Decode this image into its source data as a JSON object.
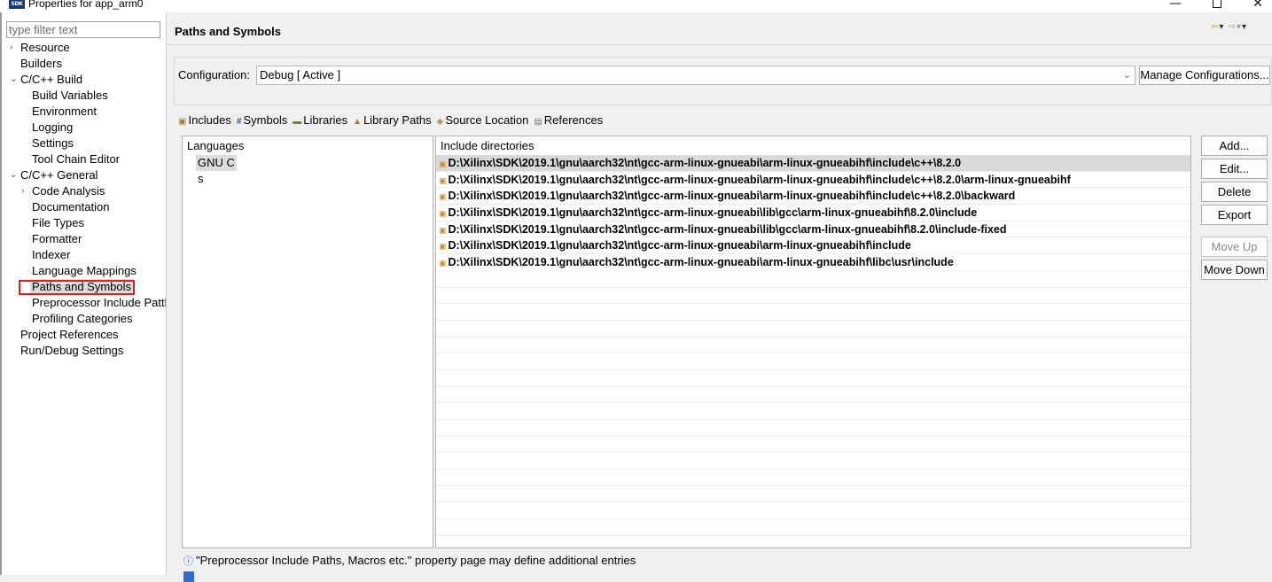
{
  "window": {
    "title": "Properties for app_arm0",
    "app_icon_text": "SDK",
    "minimize": "—",
    "close": "✕"
  },
  "filter": {
    "placeholder": "type filter text",
    "value": ""
  },
  "nav_tree": [
    {
      "label": "Resource",
      "level": 0,
      "chevron": "›"
    },
    {
      "label": "Builders",
      "level": 0,
      "chevron": ""
    },
    {
      "label": "C/C++ Build",
      "level": 0,
      "chevron": "⌄"
    },
    {
      "label": "Build Variables",
      "level": 1,
      "chevron": ""
    },
    {
      "label": "Environment",
      "level": 1,
      "chevron": ""
    },
    {
      "label": "Logging",
      "level": 1,
      "chevron": ""
    },
    {
      "label": "Settings",
      "level": 1,
      "chevron": ""
    },
    {
      "label": "Tool Chain Editor",
      "level": 1,
      "chevron": ""
    },
    {
      "label": "C/C++ General",
      "level": 0,
      "chevron": "⌄"
    },
    {
      "label": "Code Analysis",
      "level": 1,
      "chevron": "›"
    },
    {
      "label": "Documentation",
      "level": 1,
      "chevron": ""
    },
    {
      "label": "File Types",
      "level": 1,
      "chevron": ""
    },
    {
      "label": "Formatter",
      "level": 1,
      "chevron": ""
    },
    {
      "label": "Indexer",
      "level": 1,
      "chevron": ""
    },
    {
      "label": "Language Mappings",
      "level": 1,
      "chevron": ""
    },
    {
      "label": "Paths and Symbols",
      "level": 1,
      "chevron": "",
      "selected": true
    },
    {
      "label": "Preprocessor Include Pattl",
      "level": 1,
      "chevron": ""
    },
    {
      "label": "Profiling Categories",
      "level": 1,
      "chevron": ""
    },
    {
      "label": "Project References",
      "level": 0,
      "chevron": ""
    },
    {
      "label": "Run/Debug Settings",
      "level": 0,
      "chevron": ""
    }
  ],
  "page": {
    "title": "Paths and Symbols"
  },
  "configuration": {
    "label": "Configuration:",
    "selected": "Debug  [ Active ]",
    "manage_label": "Manage Configurations..."
  },
  "tabs": [
    {
      "label": "Includes",
      "icon": "include-folder-icon",
      "glyph": "▣"
    },
    {
      "label": "Symbols",
      "icon": "hash-icon",
      "glyph": "#"
    },
    {
      "label": "Libraries",
      "icon": "library-icon",
      "glyph": "▬"
    },
    {
      "label": "Library Paths",
      "icon": "library-path-icon",
      "glyph": "▲"
    },
    {
      "label": "Source Location",
      "icon": "source-folder-icon",
      "glyph": "◈"
    },
    {
      "label": "References",
      "icon": "reference-icon",
      "glyph": "▤"
    }
  ],
  "languages": {
    "header": "Languages",
    "items": [
      "GNU C",
      "s"
    ],
    "selected_index": 0
  },
  "include_dirs": {
    "header": "Include directories",
    "rows": [
      "D:\\Xilinx\\SDK\\2019.1\\gnu\\aarch32\\nt\\gcc-arm-linux-gnueabi\\arm-linux-gnueabihf\\include\\c++\\8.2.0",
      "D:\\Xilinx\\SDK\\2019.1\\gnu\\aarch32\\nt\\gcc-arm-linux-gnueabi\\arm-linux-gnueabihf\\include\\c++\\8.2.0\\arm-linux-gnueabihf",
      "D:\\Xilinx\\SDK\\2019.1\\gnu\\aarch32\\nt\\gcc-arm-linux-gnueabi\\arm-linux-gnueabihf\\include\\c++\\8.2.0\\backward",
      "D:\\Xilinx\\SDK\\2019.1\\gnu\\aarch32\\nt\\gcc-arm-linux-gnueabi\\lib\\gcc\\arm-linux-gnueabihf\\8.2.0\\include",
      "D:\\Xilinx\\SDK\\2019.1\\gnu\\aarch32\\nt\\gcc-arm-linux-gnueabi\\lib\\gcc\\arm-linux-gnueabihf\\8.2.0\\include-fixed",
      "D:\\Xilinx\\SDK\\2019.1\\gnu\\aarch32\\nt\\gcc-arm-linux-gnueabi\\arm-linux-gnueabihf\\include",
      "D:\\Xilinx\\SDK\\2019.1\\gnu\\aarch32\\nt\\gcc-arm-linux-gnueabi\\arm-linux-gnueabihf\\libc\\usr\\include"
    ],
    "selected_index": 0
  },
  "buttons": {
    "add": "Add...",
    "edit": "Edit...",
    "delete": "Delete",
    "export": "Export",
    "move_up": "Move Up",
    "move_down": "Move Down"
  },
  "info": {
    "text": "\"Preprocessor Include Paths, Macros etc.\" property page may define additional entries"
  },
  "colors": {
    "selection": "#dcdcdc",
    "highlight_box": "#e0201a",
    "folder_icon": "#c8912e"
  }
}
